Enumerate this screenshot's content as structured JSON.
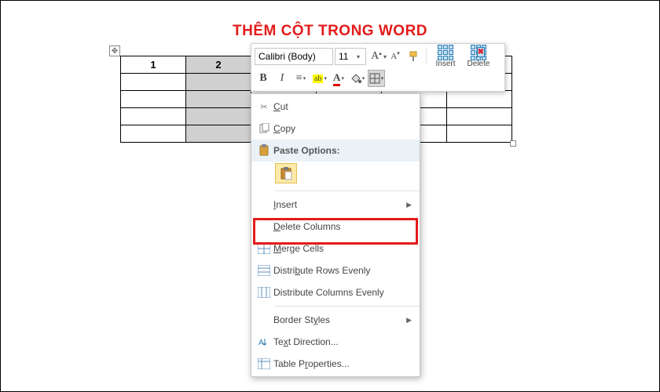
{
  "title": "THÊM CỘT TRONG WORD",
  "table": {
    "rows": 5,
    "cols": 6,
    "header": [
      "1",
      "2",
      "",
      "",
      "",
      ""
    ],
    "selected_col": 1
  },
  "mini_toolbar": {
    "font_name": "Calibri (Body)",
    "font_size": "11",
    "grow": "A",
    "shrink": "A",
    "bold": "B",
    "italic": "I",
    "align": "≡",
    "highlight": "ab",
    "font_color": "A",
    "format_painter": "⎘",
    "shading": "▦",
    "borders": "▦",
    "insert_label": "Insert",
    "delete_label": "Delete"
  },
  "context_menu": {
    "cut": "Cut",
    "copy": "Copy",
    "paste_options": "Paste Options:",
    "insert": "Insert",
    "delete_columns": "Delete Columns",
    "merge_cells": "Merge Cells",
    "distribute_rows": "Distribute Rows Evenly",
    "distribute_cols": "Distribute Columns Evenly",
    "border_styles": "Border Styles",
    "text_direction": "Text Direction...",
    "table_properties": "Table Properties..."
  }
}
